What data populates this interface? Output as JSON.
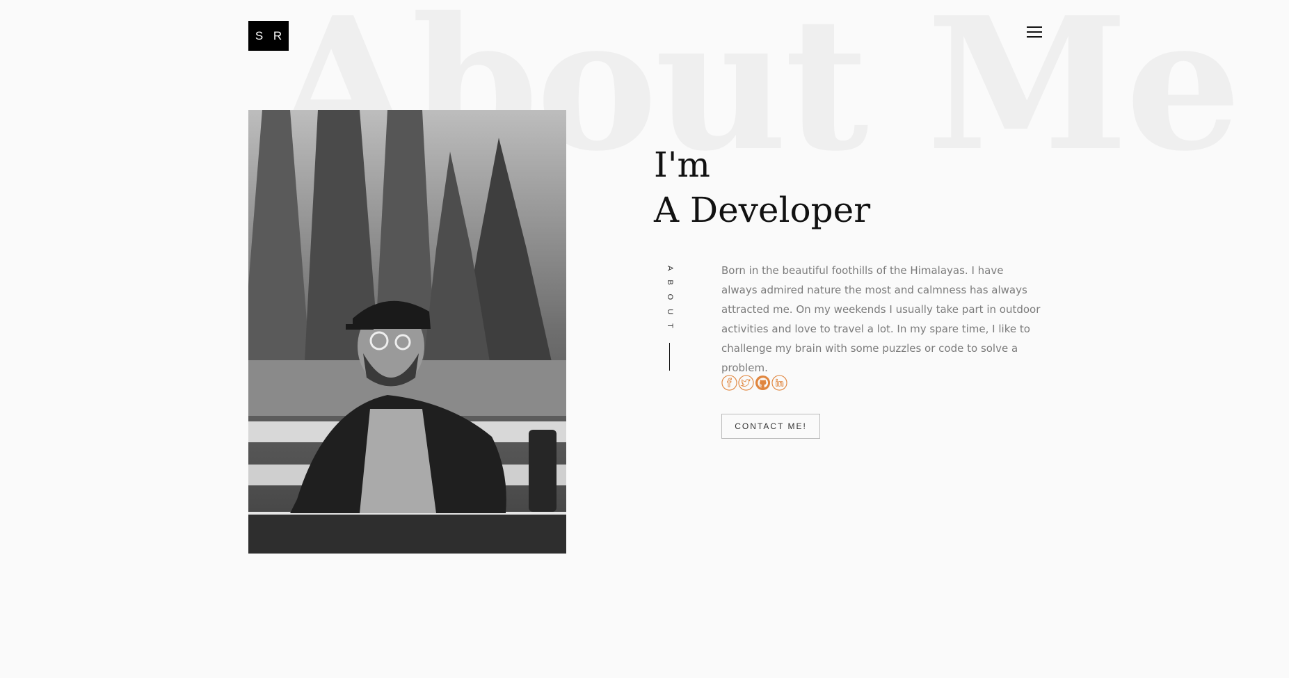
{
  "background_title": "About Me",
  "logo": {
    "text": "S R"
  },
  "menu": {
    "icon": "hamburger-menu-icon"
  },
  "hero": {
    "line1": "I'm",
    "line2": "A Developer"
  },
  "section_label": "ABOUT",
  "bio": "Born in the beautiful foothills of the Himalayas. I have always admired nature the most and calmness has always attracted me. On my weekends I usually take part in outdoor activities and love to travel a lot. In my spare time, I like to challenge my brain with some puzzles or code to solve a problem.",
  "socials": [
    {
      "icon": "facebook-icon"
    },
    {
      "icon": "twitter-icon"
    },
    {
      "icon": "github-icon"
    },
    {
      "icon": "linkedin-icon"
    }
  ],
  "contact_button": "CONTACT ME!",
  "colors": {
    "background": "#fafafa",
    "accent": "#e0863f",
    "text": "#111111",
    "muted_text": "#7b7b7b",
    "watermark": "#efefef"
  }
}
